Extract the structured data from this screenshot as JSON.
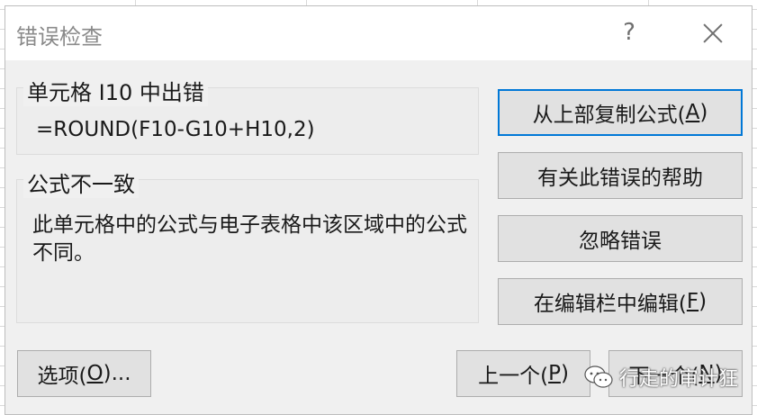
{
  "dialog": {
    "title": "错误检查",
    "help_glyph": "?",
    "close_glyph": "×"
  },
  "error_section": {
    "heading": "单元格 I10 中出错",
    "formula": "=ROUND(F10-G10+H10,2)"
  },
  "description_section": {
    "heading": "公式不一致",
    "text": "此单元格中的公式与电子表格中该区域中的公式不同。"
  },
  "buttons": {
    "copy_from_above": {
      "label": "从上部复制公式(",
      "key": "A",
      "suffix": ")"
    },
    "help_on_error": {
      "label": "有关此错误的帮助"
    },
    "ignore_error": {
      "label": "忽略错误"
    },
    "edit_in_formula_bar": {
      "label": "在编辑栏中编辑(",
      "key": "F",
      "suffix": ")"
    },
    "options": {
      "label": "选项(",
      "key": "O",
      "suffix": ")..."
    },
    "previous": {
      "label": "上一个(",
      "key": "P",
      "suffix": ")"
    },
    "next": {
      "label": "下一个(",
      "key": "N",
      "suffix": ")"
    }
  },
  "watermark": {
    "text": "行走的审计狂",
    "icon": "wechat-icon"
  },
  "colors": {
    "accent": "#0078d7",
    "dialog_bg": "#f0f0f0",
    "button_bg": "#e1e1e1"
  }
}
